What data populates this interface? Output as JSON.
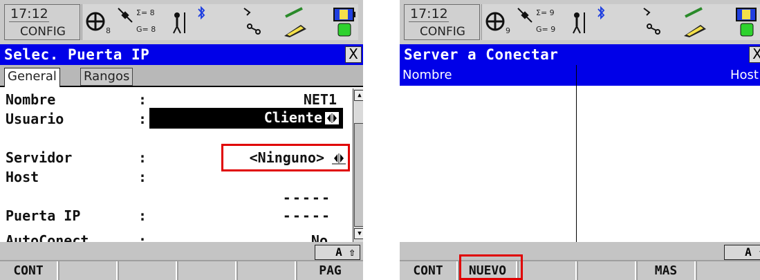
{
  "left": {
    "status": {
      "time": "17:12",
      "mode": "CONFIG",
      "sat_count": "8",
      "sigma_value": "Σ= 8",
      "g_value": "G= 8"
    },
    "title": "Selec. Puerta IP",
    "close_symbol": "X",
    "tabs": [
      {
        "label": "General",
        "active": true
      },
      {
        "label": "Rangos",
        "active": false
      }
    ],
    "fields": [
      {
        "label": "Nombre",
        "colon": ":",
        "value": "NET1"
      },
      {
        "label": "Usuario",
        "colon": ":",
        "value": "Cliente"
      },
      {
        "label": "Servidor",
        "colon": ":",
        "value": "<Ninguno>"
      },
      {
        "label": "Host",
        "colon": ":",
        "value": "-----"
      },
      {
        "label": "Puerta IP",
        "colon": ":",
        "value": "-----"
      },
      {
        "label": "AutoConect",
        "colon": ":",
        "value": "No"
      }
    ],
    "mode_indicator": "A ⇧",
    "softkeys": [
      "CONT",
      "",
      "",
      "",
      "",
      "PAG"
    ]
  },
  "right": {
    "status": {
      "time": "17:12",
      "mode": "CONFIG",
      "sat_count": "9",
      "sigma_value": "Σ= 9",
      "g_value": "G= 9"
    },
    "title": "Server a Conectar",
    "close_symbol": "X",
    "columns": [
      "Nombre",
      "Host"
    ],
    "mode_indicator": "A ⇧",
    "softkeys": [
      "CONT",
      "NUEVO",
      "",
      "",
      "MAS",
      ""
    ]
  },
  "colors": {
    "title_bar": "#0000e8",
    "highlight_box": "#e00000",
    "status_bg": "#c9c9c9"
  }
}
